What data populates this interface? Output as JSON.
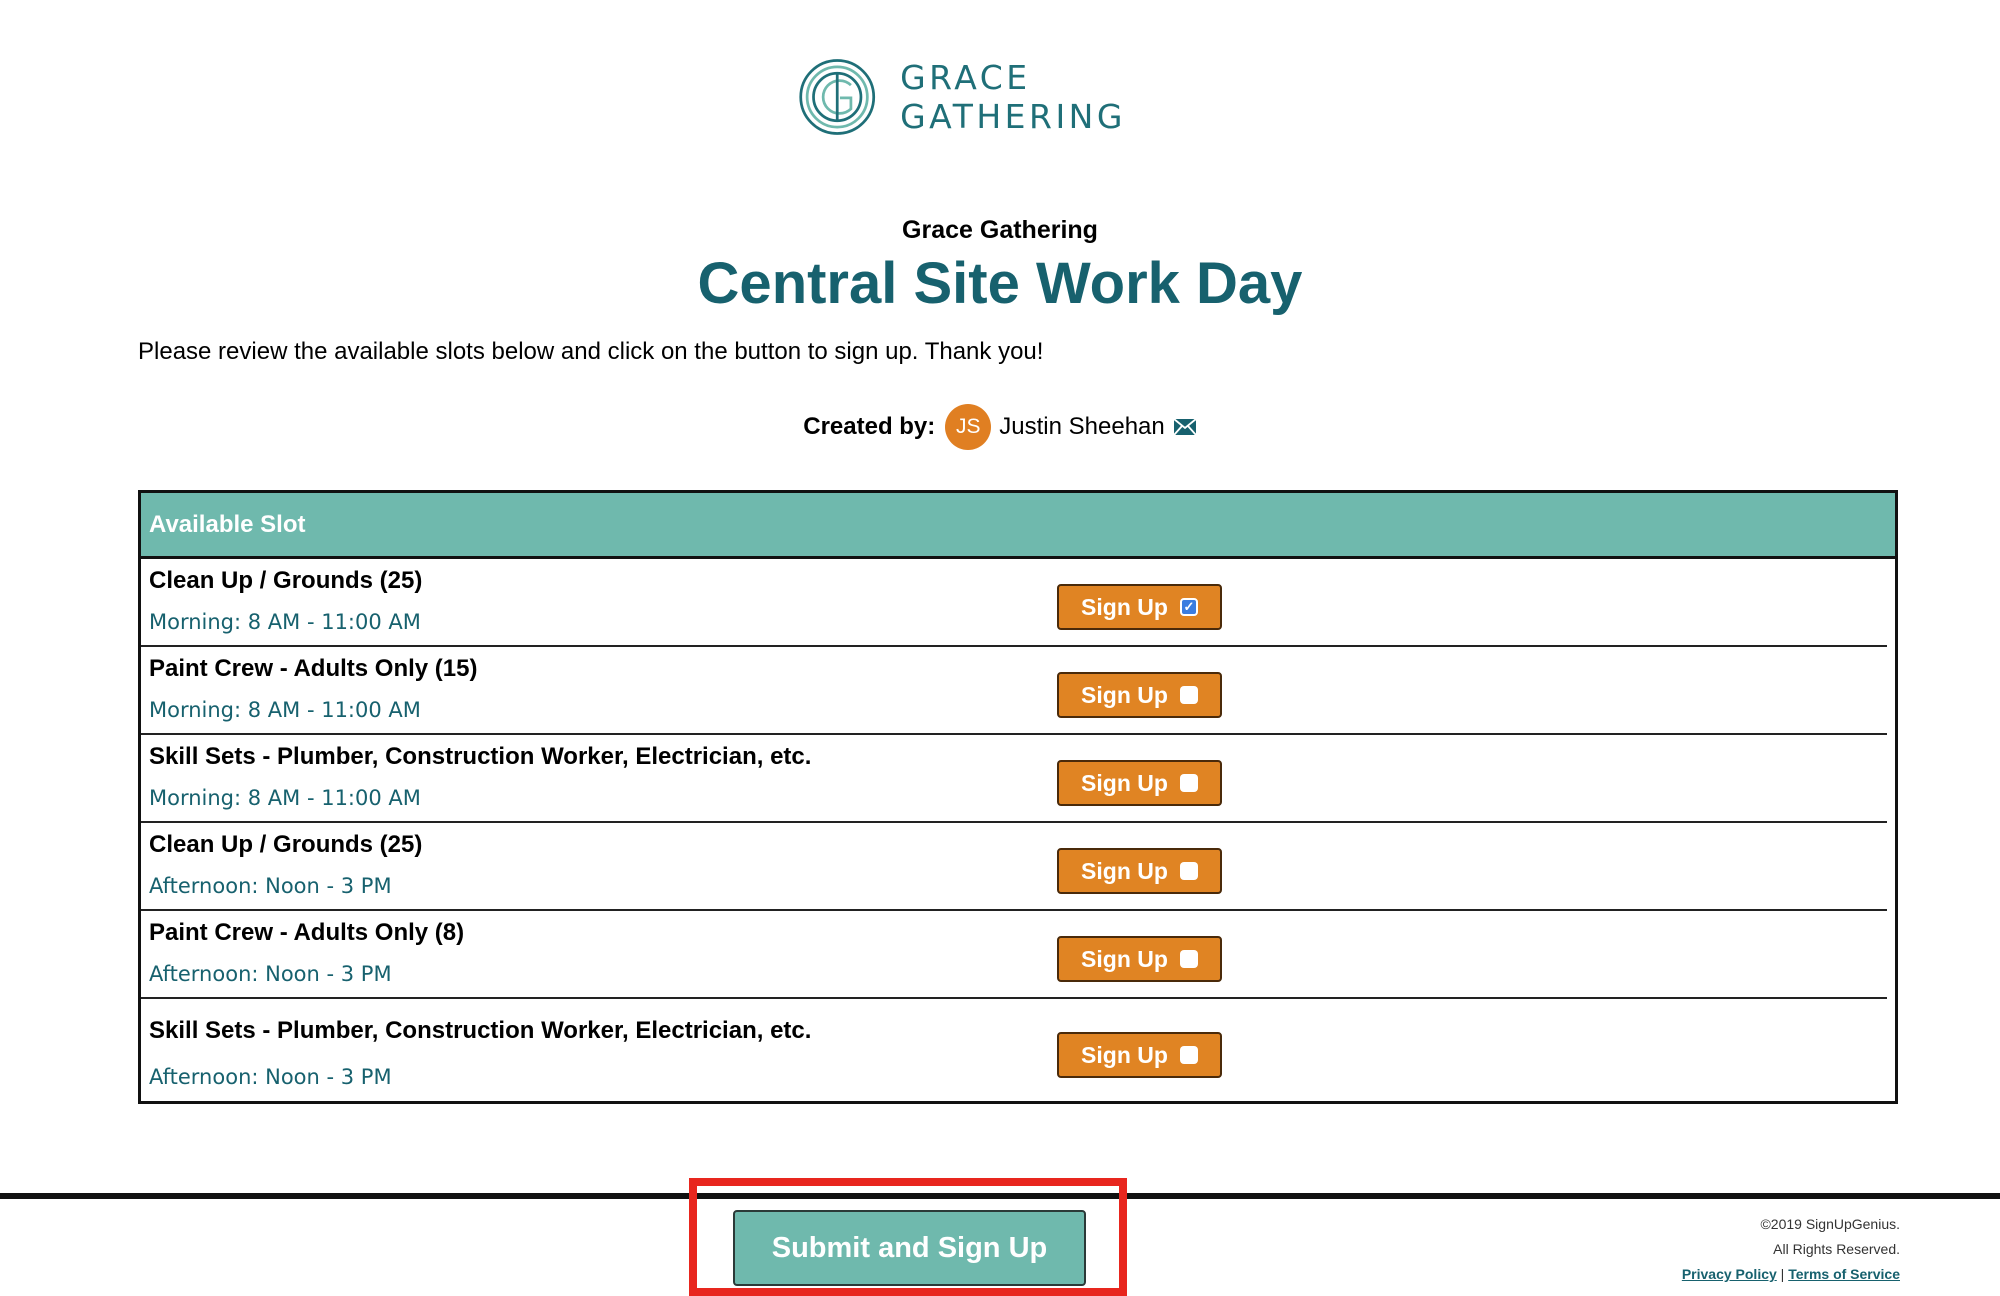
{
  "brand": {
    "logo_text": "GRACE GATHERING",
    "color": "#1f6f78"
  },
  "header": {
    "org_name": "Grace Gathering",
    "title": "Central Site Work Day",
    "intro": "Please review the available slots below and click on the button to sign up. Thank you!"
  },
  "creator": {
    "label": "Created by:",
    "initials": "JS",
    "name": "Justin Sheehan",
    "icon": "mail-icon"
  },
  "table": {
    "header": "Available Slot",
    "button_label": "Sign Up",
    "rows": [
      {
        "title": "Clean Up / Grounds (25)",
        "time": "Morning: 8 AM - 11:00 AM",
        "checked": true
      },
      {
        "title": "Paint Crew - Adults Only (15)",
        "time": "Morning: 8 AM - 11:00 AM",
        "checked": false
      },
      {
        "title": "Skill Sets - Plumber, Construction Worker, Electrician, etc.",
        "time": "Morning: 8 AM - 11:00 AM",
        "checked": false
      },
      {
        "title": "Clean Up / Grounds (25)",
        "time": "Afternoon: Noon - 3 PM",
        "checked": false
      },
      {
        "title": "Paint Crew - Adults Only (8)",
        "time": "Afternoon: Noon - 3 PM",
        "checked": false
      },
      {
        "title": "Skill Sets - Plumber, Construction Worker, Electrician, etc.",
        "time": "Afternoon: Noon - 3 PM",
        "checked": false
      }
    ]
  },
  "footer": {
    "submit_label": "Submit and Sign Up",
    "copyright": "©2019 SignUpGenius.",
    "rights": "All Rights Reserved.",
    "privacy": "Privacy Policy",
    "separator": "|",
    "terms": "Terms of Service"
  },
  "colors": {
    "accent": "#6fb9ad",
    "button": "#e08423",
    "title": "#17616e",
    "highlight": "#e8261e"
  }
}
